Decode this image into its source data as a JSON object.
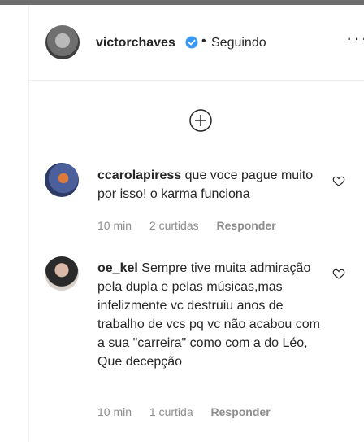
{
  "header": {
    "username": "victorchaves",
    "separator": "•",
    "follow_status": "Seguindo",
    "more_label": "···"
  },
  "comments": [
    {
      "username": "ccarolapiress",
      "text": "que voce pague muito por isso! o karma funciona",
      "time": "10 min",
      "likes": "2 curtidas",
      "reply": "Responder"
    },
    {
      "username": "oe_kel",
      "text": "Sempre tive muita admiração pela dupla e pelas músicas,mas infelizmente vc destruiu anos de trabalho de vcs pq vc não acabou com a sua \"carreira\" como com a do Léo, Que decepção",
      "time": "10 min",
      "likes": "1 curtida",
      "reply": "Responder"
    }
  ],
  "icons": {
    "verified": "verified-badge-icon",
    "load_more": "plus-circle-icon",
    "like": "heart-outline-icon"
  },
  "colors": {
    "verified_blue": "#3897f0",
    "text": "#262626",
    "muted": "#8e8e8e"
  }
}
